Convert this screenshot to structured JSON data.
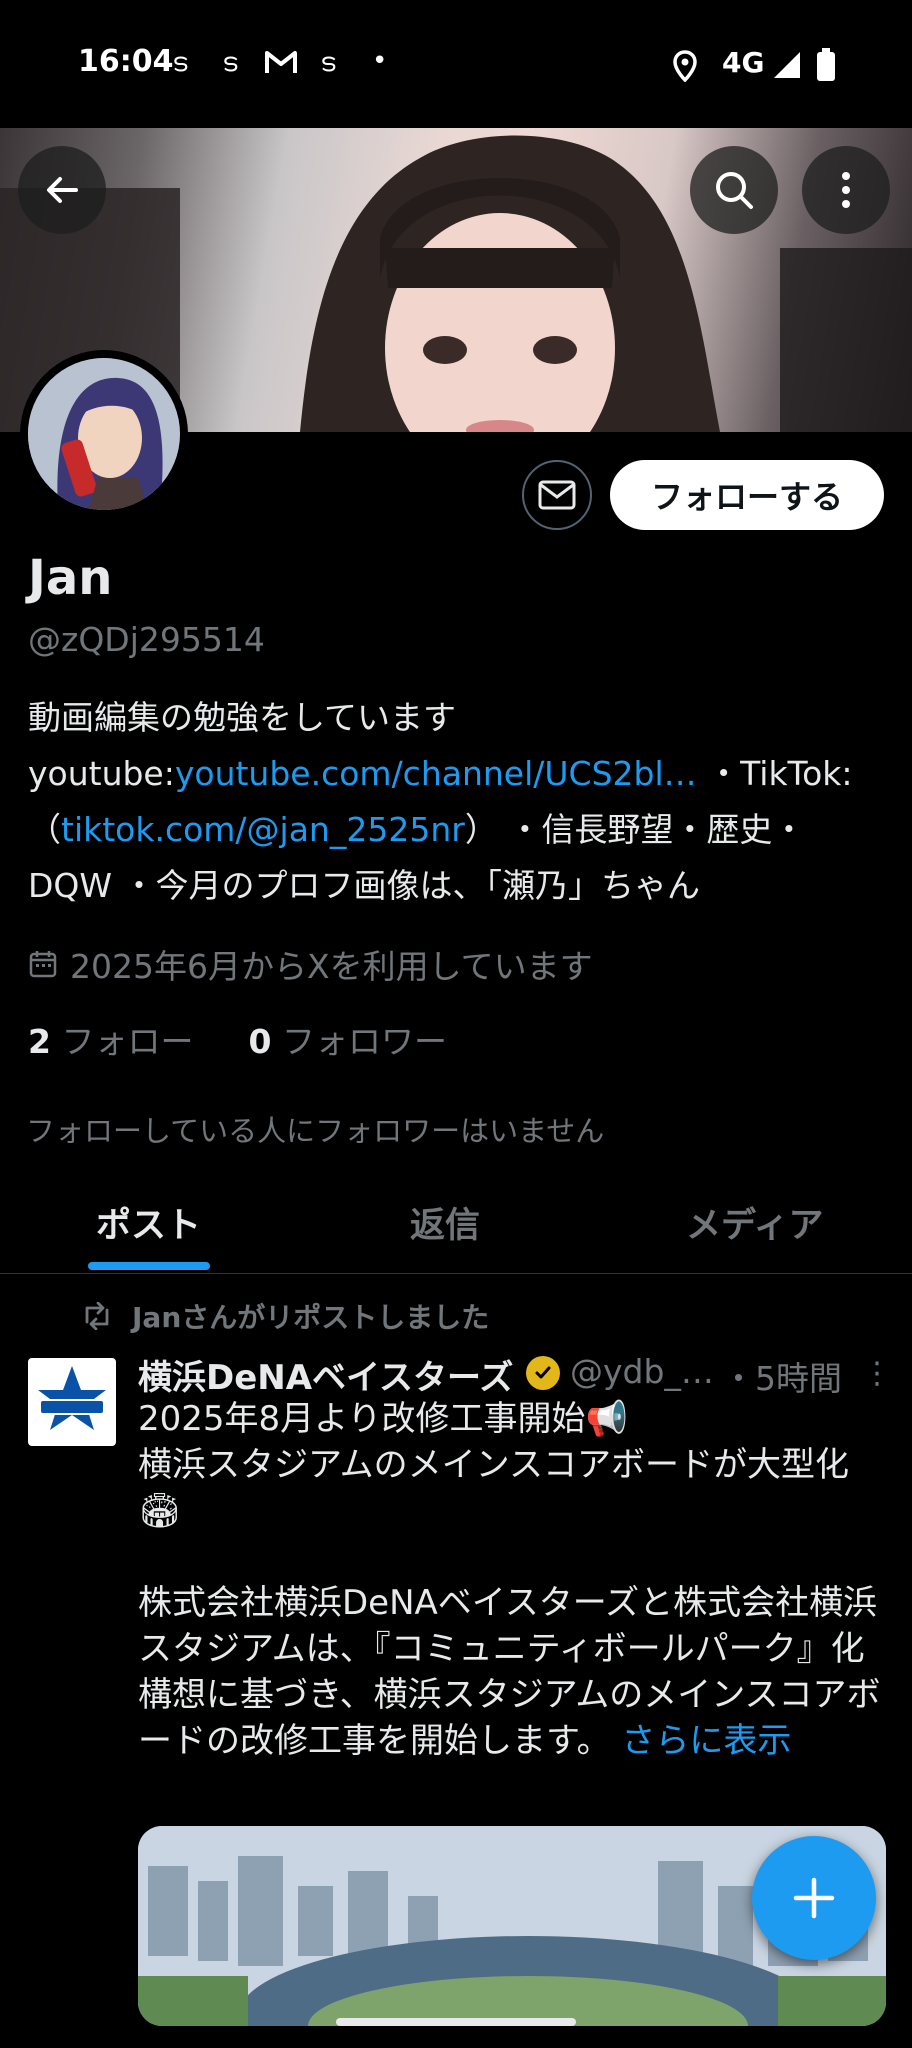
{
  "status_bar": {
    "time": "16:04",
    "network": "4G",
    "icons": [
      "s-notification-icon",
      "s-notification-icon",
      "gmail-icon",
      "s-notification-icon",
      "dot-icon",
      "location-icon",
      "signal-icon",
      "battery-icon"
    ]
  },
  "profile": {
    "follow_button": "フォローする",
    "name": "Jan",
    "handle": "@zQDj295514",
    "bio": {
      "p1": "動画編集の勉強をしています youtube:",
      "link1": "youtube.com/channel/UCS2bl…",
      "p2": " ・TikTok:（",
      "link2": "tiktok.com/@jan_2525nr",
      "p3": "） ・信長野望・歴史・DQW ・今月のプロフ画像は、「瀬乃」ちゃん"
    },
    "joined": "2025年6月からXを利用しています",
    "following_count": "2",
    "following_label": "フォロー",
    "followers_count": "0",
    "followers_label": "フォロワー",
    "no_followers_note": "フォローしている人にフォロワーはいません"
  },
  "tabs": [
    "ポスト",
    "返信",
    "メディア"
  ],
  "post": {
    "repost_label": "Janさんがリポストしました",
    "author": "横浜DeNAベイスターズ",
    "handle": "@ydb_…",
    "time": "・5時間",
    "text_line1": "2025年8月より改修工事開始📢",
    "text_line2": "横浜スタジアムのメインスコアボードが大型化🏟",
    "text_body": "株式会社横浜DeNAベイスターズと株式会社横浜スタジアムは、『コミュニティボールパーク』化構想に基づき、横浜スタジアムのメインスコアボードの改修工事を開始します。",
    "show_more": "さらに表示"
  },
  "colors": {
    "accent": "#1d9bf0",
    "background": "#000000",
    "secondary_text": "#71767b",
    "verified_gold": "#e2b719"
  }
}
